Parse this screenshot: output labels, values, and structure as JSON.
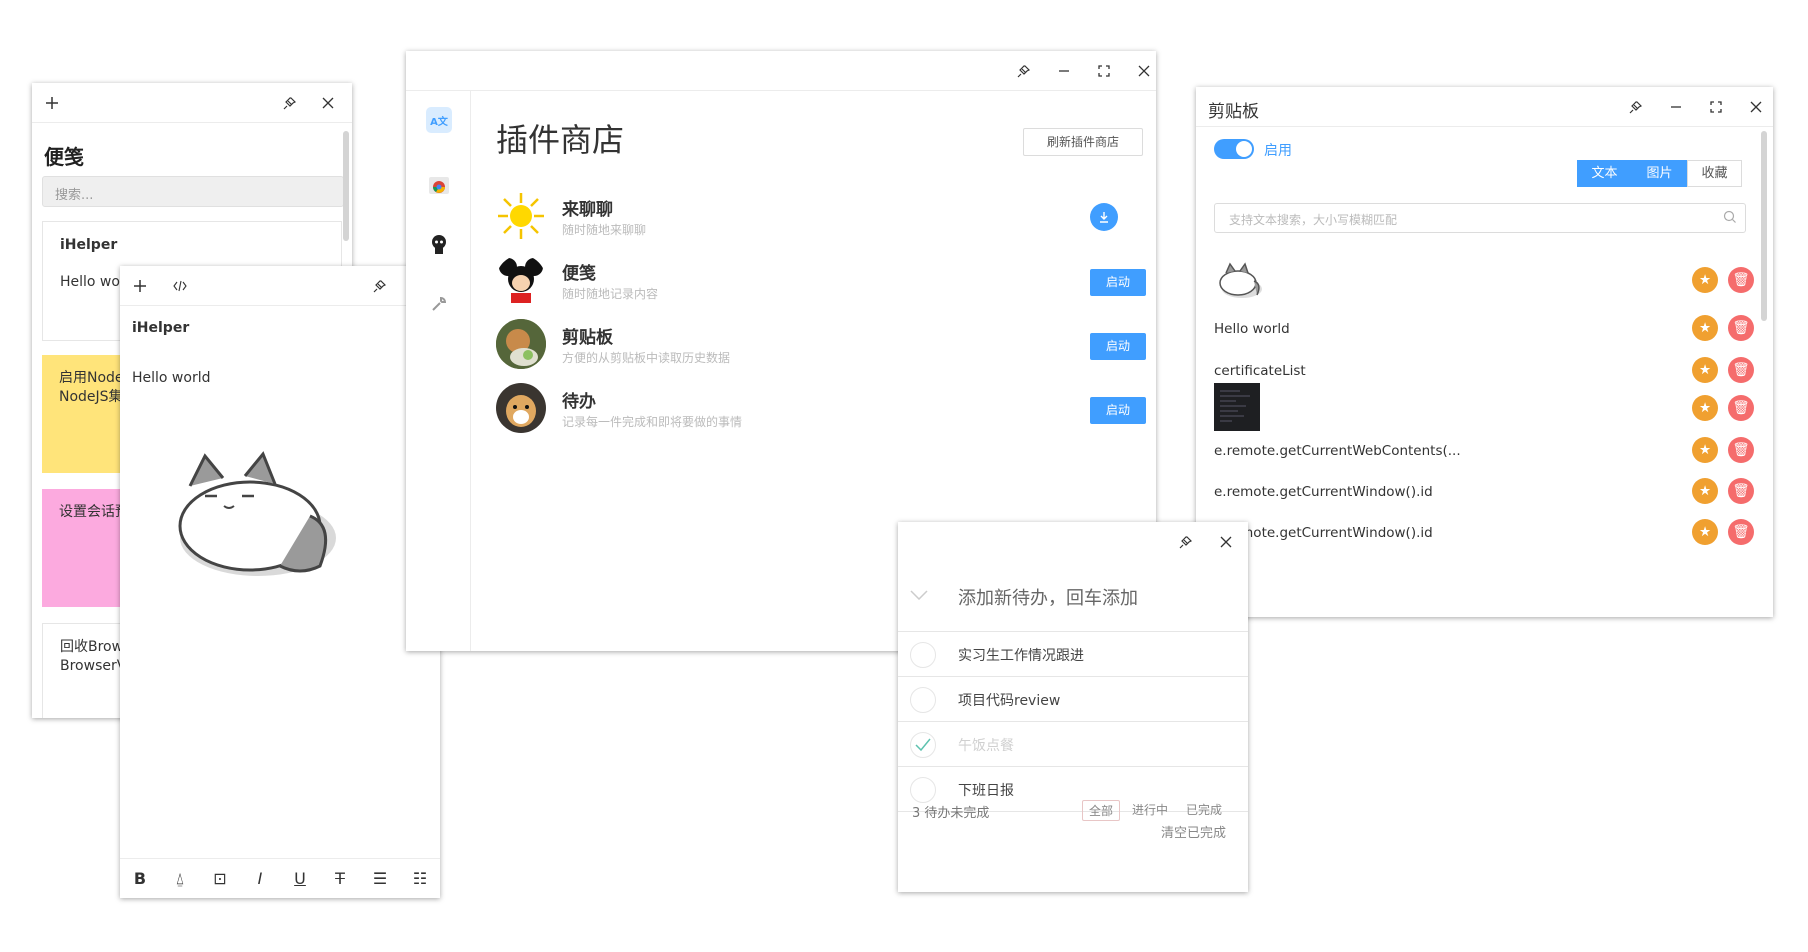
{
  "notes": {
    "title": "便笺",
    "search_placeholder": "搜索...",
    "items": [
      {
        "title": "iHelper",
        "body": "Hello world"
      },
      {
        "body": "启用NodeJS集成…启用NodeJS集成…NodeJS集成"
      },
      {
        "body": "设置会话预加载设置会话预加载会话预加载"
      },
      {
        "body": "回收BrowserView BrowserView BrowserView"
      }
    ]
  },
  "editor": {
    "heading": "iHelper",
    "body": "Hello world",
    "toolbar": [
      "B",
      "⍙",
      "⊡",
      "I",
      "U",
      "T",
      "☰",
      "☷"
    ]
  },
  "store": {
    "title": "插件商店",
    "refresh": "刷新插件商店",
    "sidebar_icon_label": "A文",
    "plugins": [
      {
        "name": "来聊聊",
        "desc": "随时随地来聊聊",
        "action": "download"
      },
      {
        "name": "便笺",
        "desc": "随时随地记录内容",
        "action": "启动"
      },
      {
        "name": "剪贴板",
        "desc": "方便的从剪贴板中读取历史数据",
        "action": "启动"
      },
      {
        "name": "待办",
        "desc": "记录每一件完成和即将要做的事情",
        "action": "启动"
      }
    ]
  },
  "clipboard": {
    "title": "剪贴板",
    "enabled_label": "启用",
    "tabs": [
      "文本",
      "图片",
      "收藏"
    ],
    "active_tab": "图片",
    "search_placeholder": "支持文本搜索，大小写模糊匹配",
    "items": [
      {
        "type": "image"
      },
      {
        "type": "text",
        "text": "Hello world"
      },
      {
        "type": "text",
        "text": "certificateList"
      },
      {
        "type": "image"
      },
      {
        "type": "text",
        "text": "e.remote.getCurrentWebContents(..."
      },
      {
        "type": "text",
        "text": "e.remote.getCurrentWindow().id"
      },
      {
        "type": "text",
        "text": "e.remote.getCurrentWindow().id"
      }
    ]
  },
  "todo": {
    "placeholder": "添加新待办，回车添加",
    "items": [
      {
        "text": "实习生工作情况跟进",
        "done": false
      },
      {
        "text": "项目代码review",
        "done": false
      },
      {
        "text": "午饭点餐",
        "done": true
      },
      {
        "text": "下班日报",
        "done": false
      }
    ],
    "remaining": "3 待办未完成",
    "filters": [
      "全部",
      "进行中",
      "已完成"
    ],
    "active_filter": "全部",
    "clear": "清空已完成"
  },
  "colors": {
    "accent": "#409eff",
    "star": "#f0a030",
    "delete": "#f56c6c",
    "note_yellow": "#ffe47a",
    "note_pink": "#fcaadf"
  }
}
